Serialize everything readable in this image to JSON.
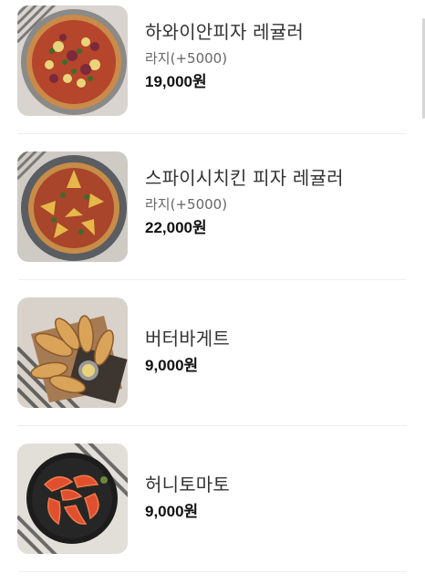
{
  "menu": {
    "items": [
      {
        "name": "하와이안피자 레귤러",
        "option": "라지(+5000)",
        "price": "19,000원",
        "image_icon": "hawaiian-pizza-photo"
      },
      {
        "name": "스파이시치킨 피자 레귤러",
        "option": "라지(+5000)",
        "price": "22,000원",
        "image_icon": "spicy-chicken-pizza-photo"
      },
      {
        "name": "버터바게트",
        "price": "9,000원",
        "image_icon": "butter-baguette-photo"
      },
      {
        "name": "허니토마토",
        "price": "9,000원",
        "image_icon": "honey-tomato-photo"
      }
    ]
  },
  "colors": {
    "background": "#ffffff",
    "divider": "#eeeeee",
    "name_text": "#333333",
    "option_text": "#666666",
    "price_text": "#111111"
  }
}
